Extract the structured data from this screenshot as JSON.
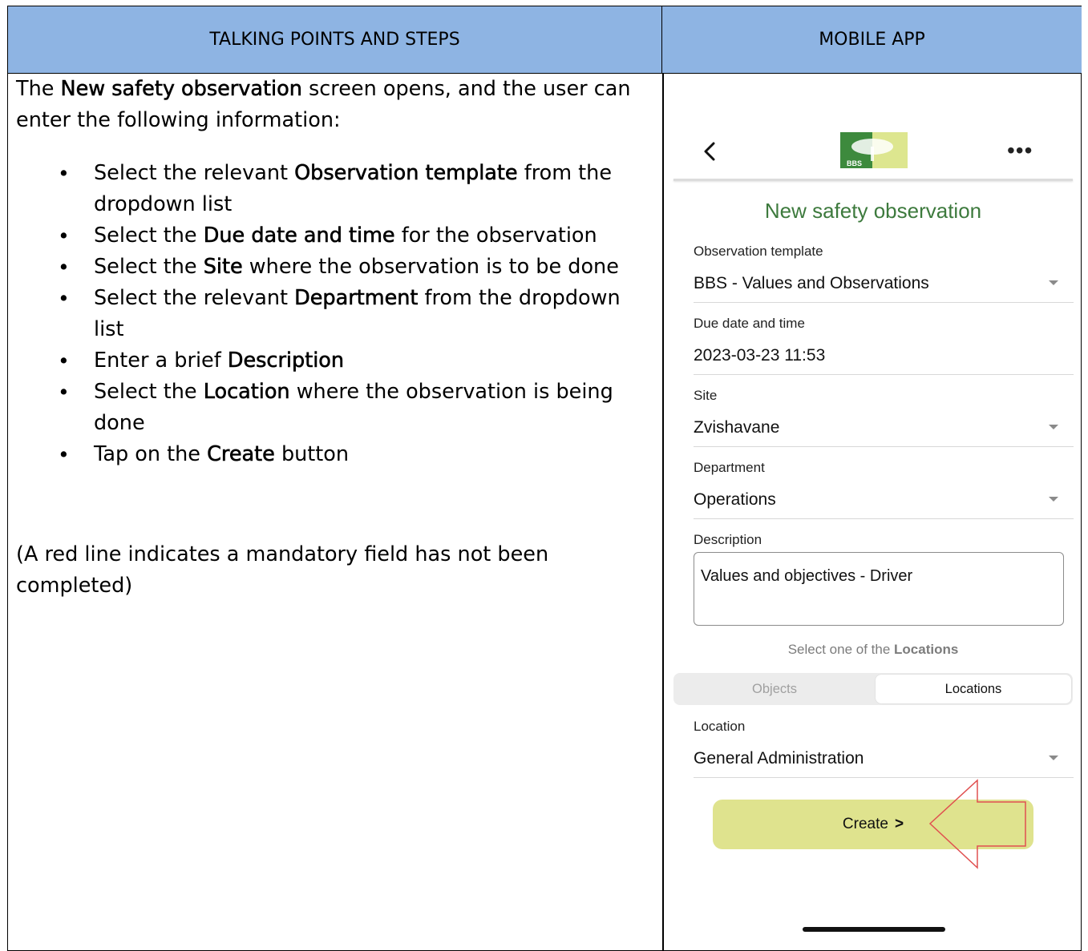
{
  "table": {
    "header_left": "TALKING POINTS AND STEPS",
    "header_right": "MOBILE APP"
  },
  "talking_points": {
    "intro_pre": "The ",
    "intro_bold": "New safety observation",
    "intro_post": " screen opens, and the user can enter the following information:",
    "steps": [
      {
        "pre": "Select the relevant ",
        "bold": "Observation template",
        "post": " from the dropdown list"
      },
      {
        "pre": "Select the ",
        "bold": "Due date and time",
        "post": " for the observation"
      },
      {
        "pre": "Select the ",
        "bold": "Site",
        "post": " where the observation is to be done"
      },
      {
        "pre": "Select the relevant ",
        "bold": "Department",
        "post": " from the dropdown list"
      },
      {
        "pre": "Enter a brief ",
        "bold": "Description",
        "post": ""
      },
      {
        "pre": "Select the ",
        "bold": "Location",
        "post": " where the observation is being done"
      },
      {
        "pre": "Tap on the ",
        "bold": "Create",
        "post": " button"
      }
    ],
    "note": "(A red line indicates a mandatory field has not been completed)"
  },
  "mobile": {
    "logo_text": "BBS",
    "screen_title": "New safety observation",
    "fields": {
      "template_label": "Observation template",
      "template_value": "BBS - Values and Observations",
      "due_label": "Due date and time",
      "due_value": "2023-03-23 11:53",
      "site_label": "Site",
      "site_value": "Zvishavane",
      "department_label": "Department",
      "department_value": "Operations",
      "description_label": "Description",
      "description_value": "Values and objectives - Driver",
      "location_label": "Location",
      "location_value": "General Administration"
    },
    "hint_pre": "Select one of the ",
    "hint_bold": "Locations",
    "tabs": [
      "Objects",
      "Locations"
    ],
    "create_label": "Create",
    "colors": {
      "header_blue": "#8eb4e3",
      "title_green": "#3d7a3d",
      "button_yellow": "#dfe38e",
      "annotation_red": "#e05050"
    }
  }
}
